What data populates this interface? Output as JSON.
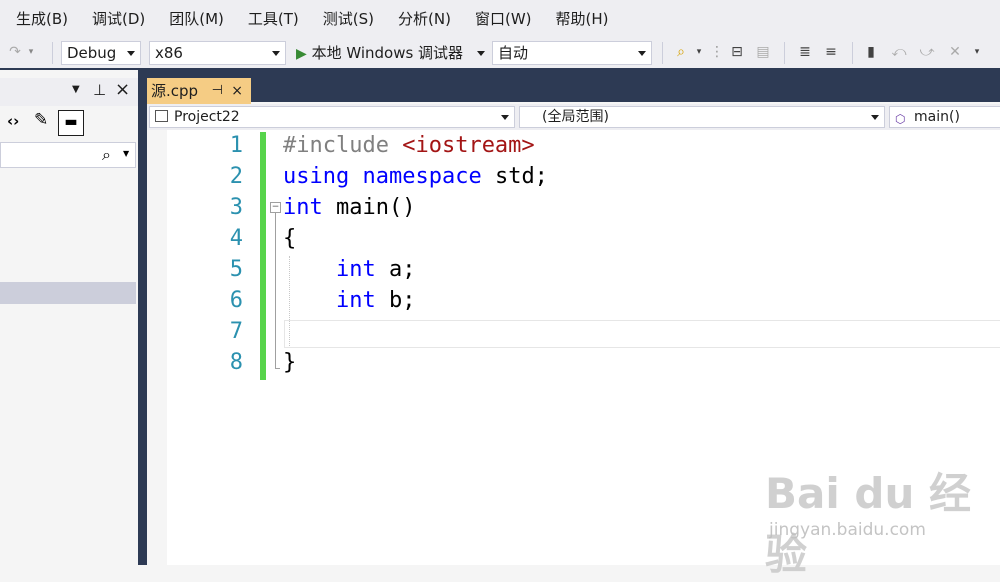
{
  "menu": [
    "生成(B)",
    "调试(D)",
    "团队(M)",
    "工具(T)",
    "测试(S)",
    "分析(N)",
    "窗口(W)",
    "帮助(H)"
  ],
  "toolbar": {
    "config": "Debug",
    "platform": "x86",
    "run_label": "本地 Windows 调试器",
    "run_mode": "自动"
  },
  "editor_tab": {
    "title": "源.cpp",
    "pin": "⊣",
    "close": "×"
  },
  "navbar": {
    "project": "Project22",
    "scope": "(全局范围)",
    "member": "main()"
  },
  "code": {
    "line_numbers": [
      "1",
      "2",
      "3",
      "4",
      "5",
      "6",
      "7",
      "8"
    ],
    "include_kw": "#include",
    "include_hdr": "<iostream>",
    "using_kw": "using",
    "namespace_kw": "namespace",
    "using_rest": " std;",
    "int_kw": "int",
    "main_rest": " main()",
    "open_brace": "{",
    "var_a": " a;",
    "var_b": " b;",
    "close_brace": "}"
  },
  "watermark": {
    "logo": "Bai du 经验",
    "url": "jingyan.baidu.com"
  },
  "colors": {
    "keyword": "#0000ff",
    "preprocessor": "#808080",
    "string": "#a31515",
    "line_number": "#2b91af",
    "change_bar": "#57d44b",
    "tab_active": "#f5cc84",
    "chrome_dark": "#2d3a54"
  }
}
